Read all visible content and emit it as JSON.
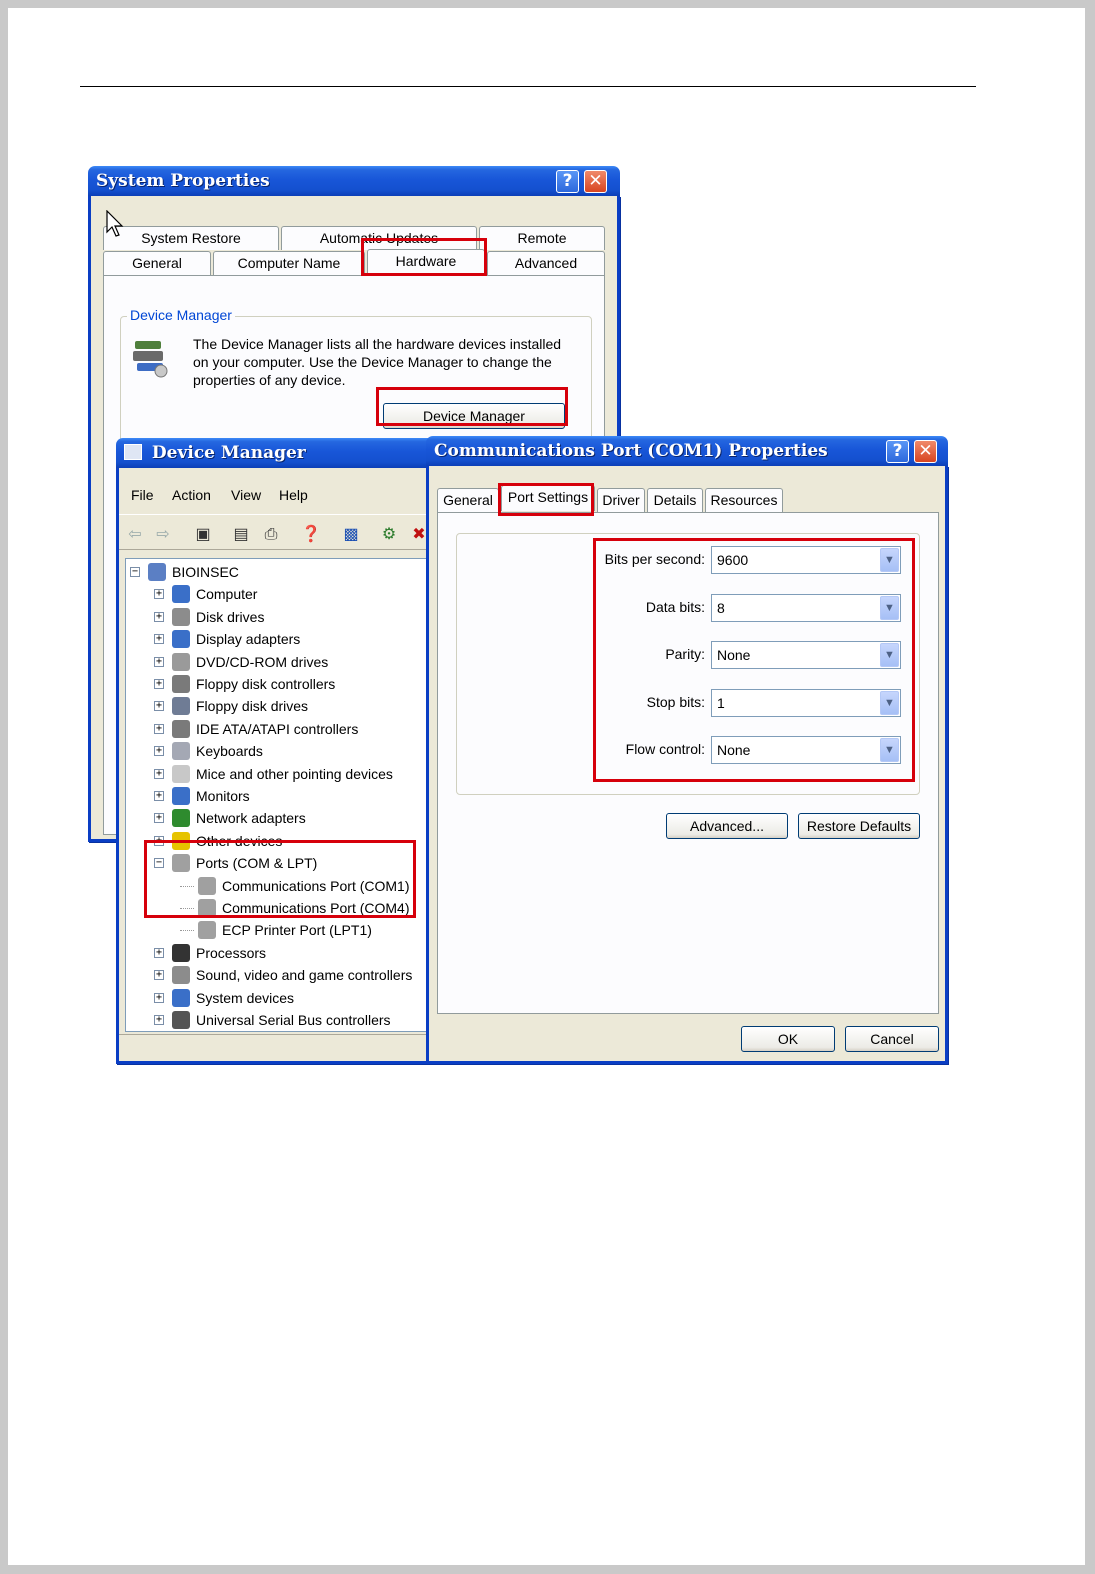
{
  "system_properties": {
    "title": "System Properties",
    "tabs_row1": [
      "System Restore",
      "Automatic Updates",
      "Remote"
    ],
    "tabs_row2": [
      "General",
      "Computer Name",
      "Hardware",
      "Advanced"
    ],
    "group_title": "Device Manager",
    "description_lines": [
      "The Device Manager lists all the hardware devices installed",
      "on your computer. Use the Device Manager to change the",
      "properties of any device."
    ],
    "device_manager_button": "Device Manager",
    "help_glyph": "?",
    "close_glyph": "✕"
  },
  "device_manager": {
    "title": "Device Manager",
    "menu": [
      "File",
      "Action",
      "View",
      "Help"
    ],
    "toolbar_icons": [
      "back-icon",
      "forward-icon",
      "view-icon",
      "properties-icon",
      "print-icon",
      "help-icon",
      "update-icon",
      "scan-icon",
      "uninstall-icon"
    ],
    "root": "BIOINSEC",
    "tree": [
      {
        "label": "Computer",
        "icon": "computer-icon",
        "color": "#3a6fc8"
      },
      {
        "label": "Disk drives",
        "icon": "disk-drive-icon",
        "color": "#8c8c8c"
      },
      {
        "label": "Display adapters",
        "icon": "display-adapter-icon",
        "color": "#3a6fc8"
      },
      {
        "label": "DVD/CD-ROM drives",
        "icon": "dvd-drive-icon",
        "color": "#9a9a9a"
      },
      {
        "label": "Floppy disk controllers",
        "icon": "floppy-controller-icon",
        "color": "#7a7a7a"
      },
      {
        "label": "Floppy disk drives",
        "icon": "floppy-drive-icon",
        "color": "#6f7c95"
      },
      {
        "label": "IDE ATA/ATAPI controllers",
        "icon": "ide-controller-icon",
        "color": "#7a7a7a"
      },
      {
        "label": "Keyboards",
        "icon": "keyboard-icon",
        "color": "#a4a8b4"
      },
      {
        "label": "Mice and other pointing devices",
        "icon": "mouse-icon",
        "color": "#c8c8c8"
      },
      {
        "label": "Monitors",
        "icon": "monitor-icon",
        "color": "#3a6fc8"
      },
      {
        "label": "Network adapters",
        "icon": "network-adapter-icon",
        "color": "#2e8b2e"
      },
      {
        "label": "Other devices",
        "icon": "unknown-device-icon",
        "color": "#e6c300"
      },
      {
        "label": "Ports (COM & LPT)",
        "icon": "port-icon",
        "color": "#a0a0a0",
        "expanded": true
      },
      {
        "label": "Communications Port (COM1)",
        "icon": "port-icon",
        "color": "#a0a0a0",
        "child": true
      },
      {
        "label": "Communications Port (COM4)",
        "icon": "port-icon",
        "color": "#a0a0a0",
        "child": true
      },
      {
        "label": "ECP Printer Port (LPT1)",
        "icon": "port-icon",
        "color": "#a0a0a0",
        "child": true
      },
      {
        "label": "Processors",
        "icon": "processor-icon",
        "color": "#333333"
      },
      {
        "label": "Sound, video and game controllers",
        "icon": "sound-icon",
        "color": "#8c8c8c"
      },
      {
        "label": "System devices",
        "icon": "system-device-icon",
        "color": "#3a6fc8"
      },
      {
        "label": "Universal Serial Bus controllers",
        "icon": "usb-icon",
        "color": "#555555"
      }
    ]
  },
  "com_properties": {
    "title": "Communications Port (COM1) Properties",
    "tabs": [
      "General",
      "Port Settings",
      "Driver",
      "Details",
      "Resources"
    ],
    "fields": [
      {
        "label": "Bits per second:",
        "value": "9600"
      },
      {
        "label": "Data bits:",
        "value": "8"
      },
      {
        "label": "Parity:",
        "value": "None"
      },
      {
        "label": "Stop bits:",
        "value": "1"
      },
      {
        "label": "Flow control:",
        "value": "None"
      }
    ],
    "advanced_button": "Advanced...",
    "restore_button": "Restore Defaults",
    "ok_button": "OK",
    "cancel_button": "Cancel",
    "combo_arrow": "▼"
  },
  "colors": {
    "title_blue": "#1856d8",
    "highlight_red": "#d6000b",
    "window_face": "#ece9d8"
  }
}
